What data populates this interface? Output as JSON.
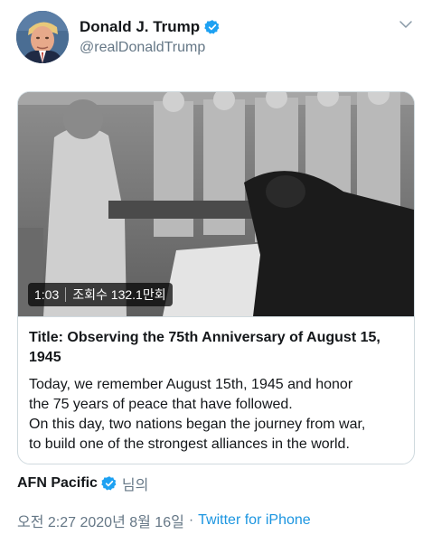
{
  "author": {
    "display_name": "Donald J. Trump",
    "handle": "@realDonaldTrump",
    "verified_icon": "verified-badge-icon",
    "menu_icon": "chevron-down-icon"
  },
  "card": {
    "video": {
      "duration": "1:03",
      "views": "조회수 132.1만회"
    },
    "title": "Title: Observing the 75th Anniversary of August 15, 1945",
    "description": [
      "Today, we remember August 15th, 1945 and honor",
      "the 75 years of peace that have followed.",
      "On this day, two nations began the journey from war,",
      "to build one of the strongest alliances in the world."
    ]
  },
  "attribution": {
    "name": "AFN Pacific",
    "suffix": "님의"
  },
  "meta": {
    "time": "오전 2:27",
    "date": "2020년 8월 16일",
    "separator": "·",
    "source": "Twitter for iPhone"
  },
  "colors": {
    "accent": "#1da1f2",
    "link": "#1b95e0",
    "secondary_text": "#657786",
    "border": "#cfd9de"
  }
}
